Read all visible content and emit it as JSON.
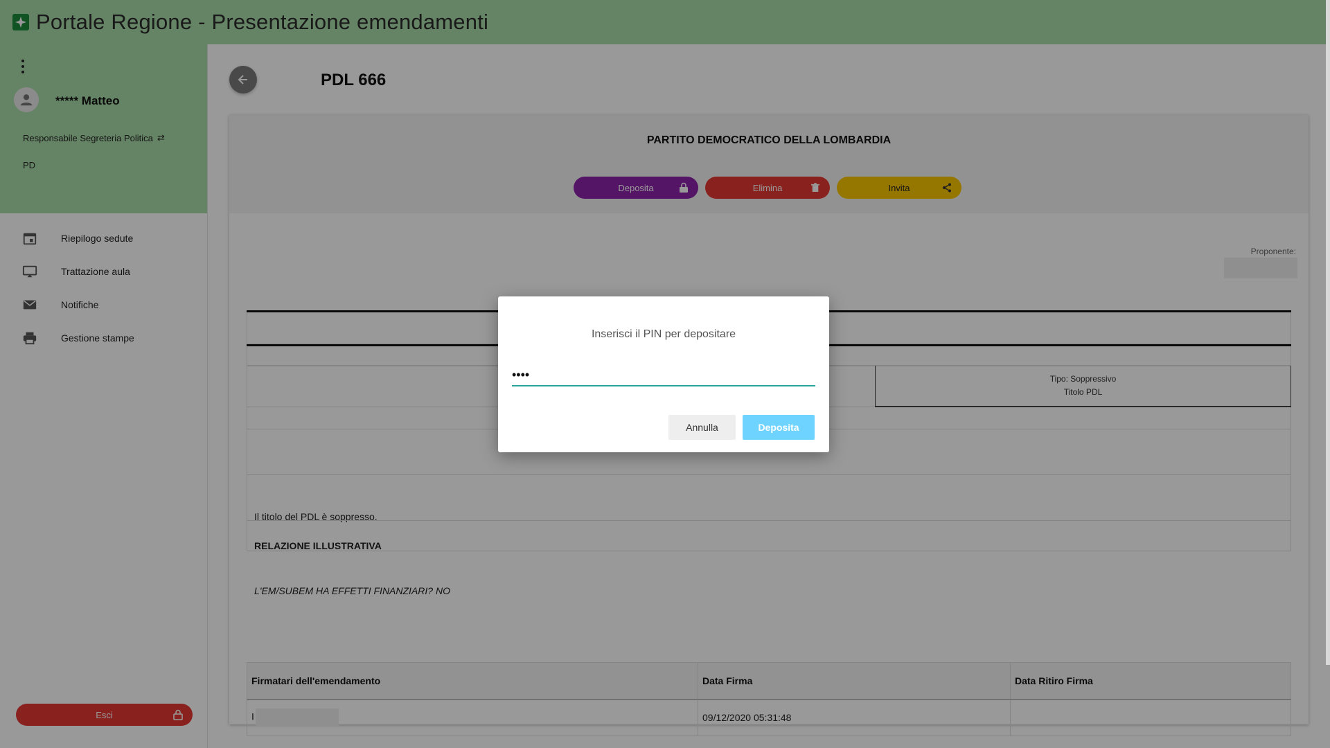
{
  "app": {
    "title": "Portale Regione - Presentazione emendamenti"
  },
  "user": {
    "name": "***** Matteo",
    "role": "Responsabile Segreteria Politica",
    "group": "PD"
  },
  "nav": {
    "items": [
      {
        "label": "Riepilogo sedute",
        "icon": "calendar-icon"
      },
      {
        "label": "Trattazione aula",
        "icon": "monitor-icon"
      },
      {
        "label": "Notifiche",
        "icon": "mail-icon"
      },
      {
        "label": "Gestione stampe",
        "icon": "printer-icon"
      }
    ],
    "logout_label": "Esci"
  },
  "page": {
    "title": "PDL 666",
    "party": "PARTITO DEMOCRATICO DELLA LOMBARDIA",
    "actions": {
      "deposit": "Deposita",
      "delete": "Elimina",
      "invite": "Invita"
    },
    "proponente_label": "Proponente:",
    "tipo_line1": "Tipo: Soppressivo",
    "tipo_line2": "Titolo PDL",
    "body_text": "Il titolo del PDL è soppresso.",
    "relazione_heading": "RELAZIONE ILLUSTRATIVA",
    "finance_text": "L'EM/SUBEM HA EFFETTI FINANZIARI? NO"
  },
  "signatures": {
    "headers": [
      "Firmatari dell'emendamento",
      "Data Firma",
      "Data Ritiro Firma"
    ],
    "rows": [
      {
        "name": "I",
        "date": "09/12/2020 05:31:48",
        "withdrawn": ""
      }
    ]
  },
  "dialog": {
    "title": "Inserisci il PIN per depositare",
    "pin_value": "••••",
    "cancel_label": "Annulla",
    "confirm_label": "Deposita"
  },
  "colors": {
    "header_bg": "#a9dca8",
    "deposit": "#8e24aa",
    "delete": "#e53935",
    "invite": "#f9c700",
    "dialog_confirm": "#6ed4ff",
    "input_underline": "#26a69a"
  }
}
